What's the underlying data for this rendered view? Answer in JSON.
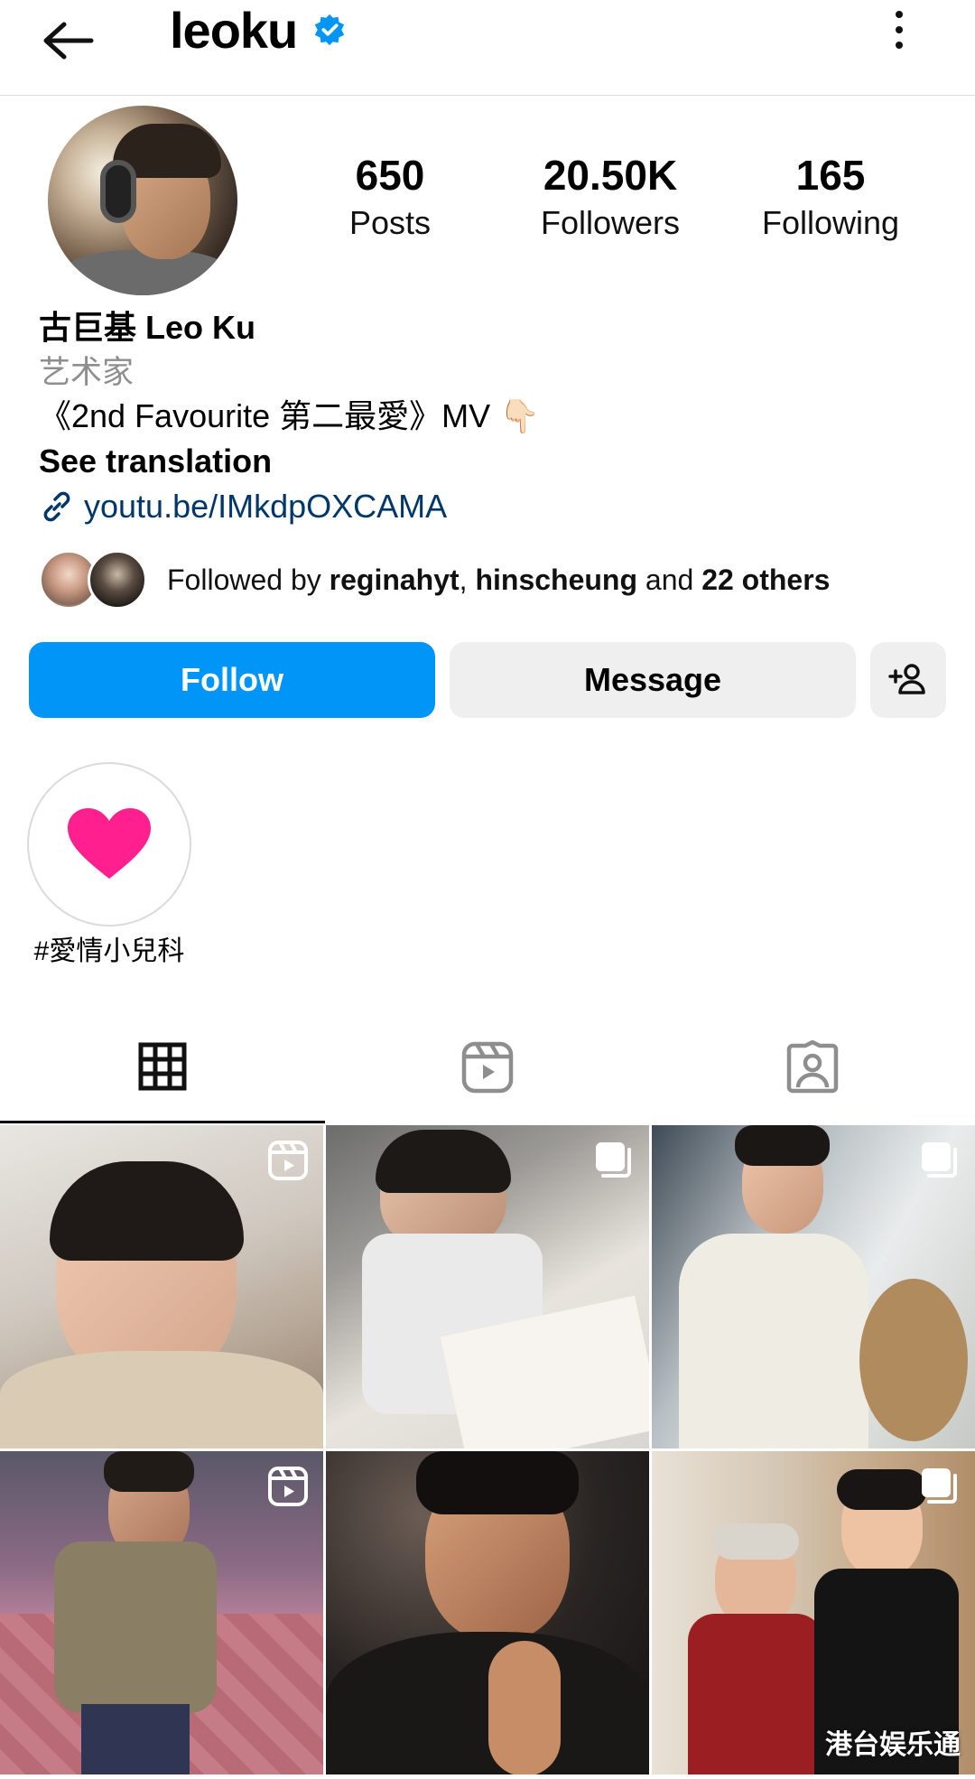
{
  "header": {
    "username": "leoku",
    "back_icon": "arrow-left-icon",
    "verified_icon": "verified-badge-icon",
    "more_icon": "more-vertical-icon"
  },
  "profile": {
    "stats": {
      "posts_value": "650",
      "posts_label": "Posts",
      "followers_value": "20.50K",
      "followers_label": "Followers",
      "following_value": "165",
      "following_label": "Following"
    },
    "full_name": "古巨基 Leo Ku",
    "category": "艺术家",
    "bio": "《2nd Favourite 第二最愛》MV 👇🏻",
    "see_translation": "See translation",
    "link": "youtu.be/IMkdpOXCAMA",
    "followed_by": {
      "prefix": "Followed by ",
      "user1": "reginahyt",
      "sep": ", ",
      "user2": "hinscheung",
      "and": " and ",
      "others": "22 others"
    }
  },
  "actions": {
    "follow_label": "Follow",
    "message_label": "Message",
    "add_user_icon": "add-person-icon"
  },
  "highlights": [
    {
      "label": "#愛情小兒科",
      "icon": "heart-icon"
    }
  ],
  "tabs": [
    {
      "name": "grid",
      "icon": "grid-icon",
      "active": true
    },
    {
      "name": "reels",
      "icon": "reels-icon",
      "active": false
    },
    {
      "name": "tagged",
      "icon": "tagged-person-icon",
      "active": false
    }
  ],
  "grid": {
    "watermark": "港台娱乐通",
    "badges": [
      "reel-icon",
      "carousel-icon",
      "carousel-icon",
      "reel-icon",
      "",
      "carousel-icon"
    ]
  },
  "colors": {
    "accent": "#0095f6",
    "link": "#00376b",
    "secondary_text": "#8e8e8e",
    "button_gray": "#efefef",
    "heart": "#ff1f8e"
  }
}
